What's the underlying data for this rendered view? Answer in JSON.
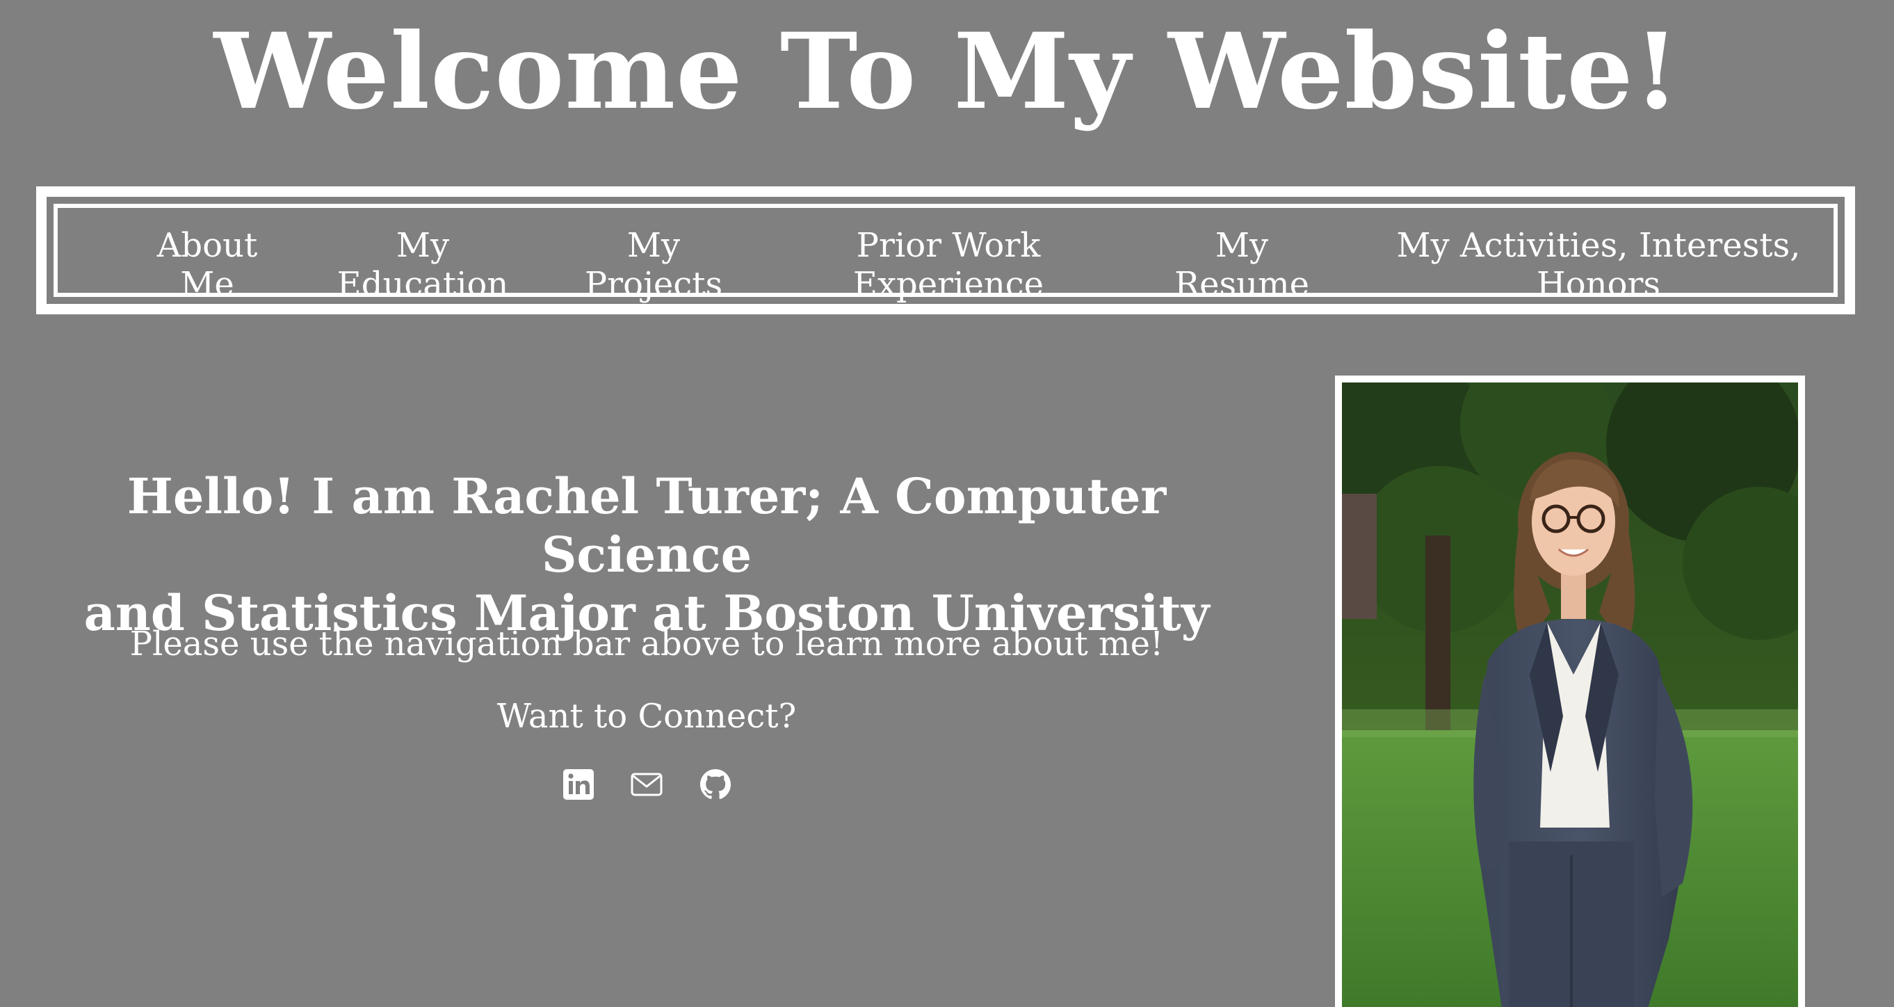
{
  "header": {
    "title": "Welcome To My Website!"
  },
  "nav": {
    "items": [
      {
        "line1": "About",
        "line2": "Me"
      },
      {
        "line1": "My",
        "line2": "Education"
      },
      {
        "line1": "My",
        "line2": "Projects"
      },
      {
        "line1": "Prior Work",
        "line2": "Experience"
      },
      {
        "line1": "My",
        "line2": "Resume"
      },
      {
        "line1": "My Activities, Interests,",
        "line2": "Honors"
      }
    ]
  },
  "main": {
    "hello_line1": "Hello! I am Rachel Turer; A Computer Science",
    "hello_line2": "and Statistics Major at Boston University",
    "nav_hint": "Please use the navigation bar above to learn more about me!",
    "connect": "Want to Connect?",
    "social_icons": [
      "linkedin-icon",
      "mail-icon",
      "github-icon"
    ]
  },
  "colors": {
    "background": "#808080",
    "text": "#ffffff"
  }
}
